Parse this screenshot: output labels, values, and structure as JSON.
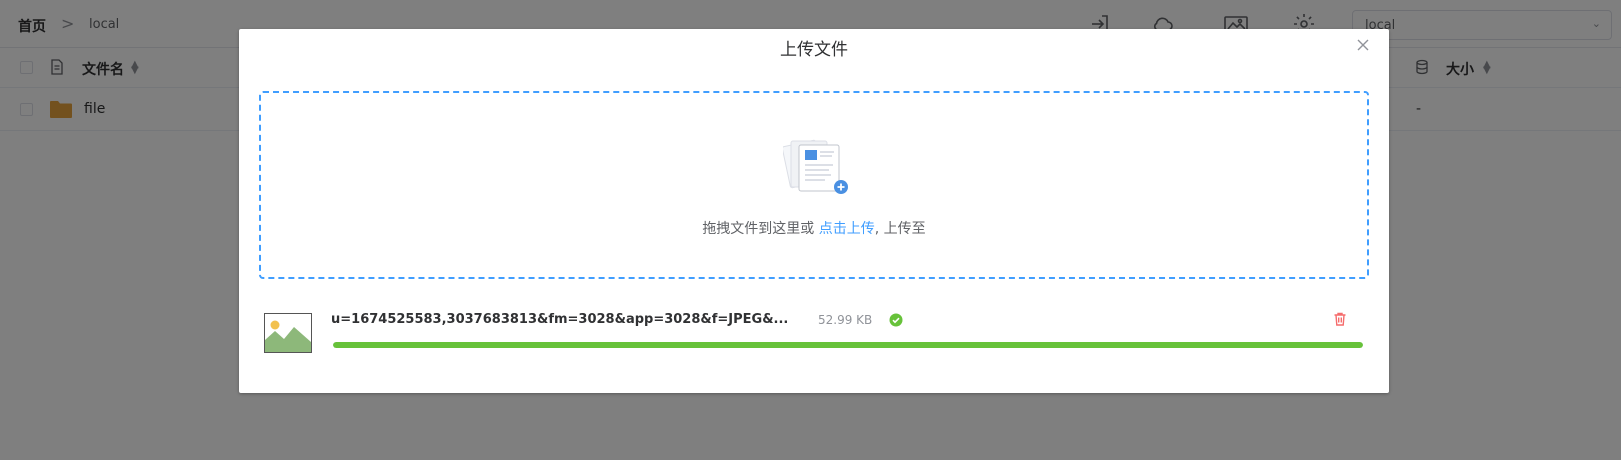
{
  "breadcrumb": {
    "home": "首页",
    "separator": ">",
    "current": "local"
  },
  "toolbar": {
    "icons": [
      "logout-icon",
      "cloud-icon",
      "gallery-icon",
      "settings-icon"
    ],
    "drive_select_value": "local"
  },
  "table": {
    "columns": [
      {
        "label": "文件名",
        "icon": "file-icon"
      },
      {
        "label": "大小",
        "icon": "database-icon"
      }
    ],
    "rows": [
      {
        "name": "file",
        "type": "folder",
        "size": "-"
      }
    ]
  },
  "dialog": {
    "title": "上传文件",
    "dropzone": {
      "text_before": "拖拽文件到这里或 ",
      "link": "点击上传",
      "text_after": ", 上传至"
    },
    "files": [
      {
        "name": "u=1674525583,3037683813&fm=3028&app=3028&f=JPEG&...",
        "size": "52.99 KB",
        "status": "success",
        "progress": 1.0
      }
    ]
  },
  "colors": {
    "accent": "#409eff",
    "success": "#67c23a",
    "danger": "#f56c6c",
    "folder": "#e6a23c"
  }
}
